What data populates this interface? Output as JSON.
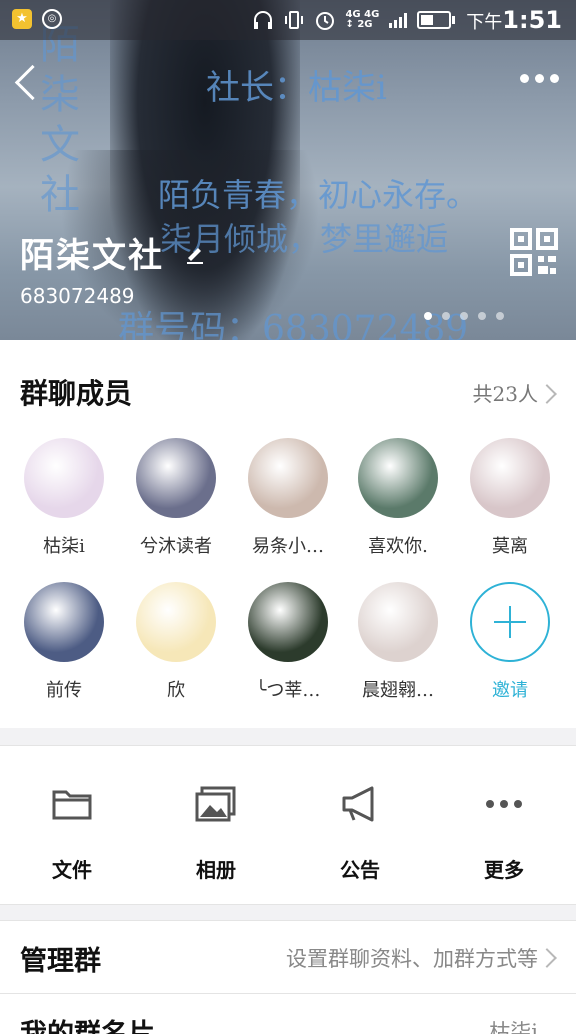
{
  "status_bar": {
    "time_prefix": "下午",
    "time": "1:51",
    "network": [
      "4G",
      "4G",
      "2G"
    ]
  },
  "header": {
    "group_name": "陌柒文社",
    "group_number": "683072489",
    "background_watermark": {
      "line_1": "社长：",
      "line_1_name": "枯柒i",
      "line_2": "陌负青春，初心永存。",
      "line_3": "柒月倾城，梦里邂逅",
      "line_4_label": "群号码：",
      "line_4_number": "683072489",
      "vertical": "陌柒文社"
    },
    "page_dots": 5,
    "active_dot": 0
  },
  "members": {
    "title": "群聊成员",
    "count_label": "共23人",
    "list": [
      {
        "name": "枯柒i",
        "color": "#e6d7ea"
      },
      {
        "name": "兮沐读者",
        "color": "#6b6f8c"
      },
      {
        "name": "易条小…",
        "color": "#cdb9ae"
      },
      {
        "name": "喜欢你.",
        "color": "#5b7a6a"
      },
      {
        "name": "莫离",
        "color": "#d8c6c9"
      },
      {
        "name": "前传",
        "color": "#4d5c84"
      },
      {
        "name": "欣",
        "color": "#f6e7b8"
      },
      {
        "name": "╰つ莘…",
        "color": "#2c3b2c"
      },
      {
        "name": "晨翅翱…",
        "color": "#ddd2cf"
      }
    ],
    "invite_label": "邀请"
  },
  "actions": [
    {
      "label": "文件",
      "icon": "folder-icon"
    },
    {
      "label": "相册",
      "icon": "photo-album-icon"
    },
    {
      "label": "公告",
      "icon": "megaphone-icon"
    },
    {
      "label": "更多",
      "icon": "more-dots-icon"
    }
  ],
  "manage": {
    "title": "管理群",
    "description": "设置群聊资料、加群方式等"
  },
  "nickname_row": {
    "title": "我的群名片",
    "value": "枯柒i"
  },
  "colors": {
    "accent": "#2eb2d6",
    "watermark": "#6096d2"
  }
}
